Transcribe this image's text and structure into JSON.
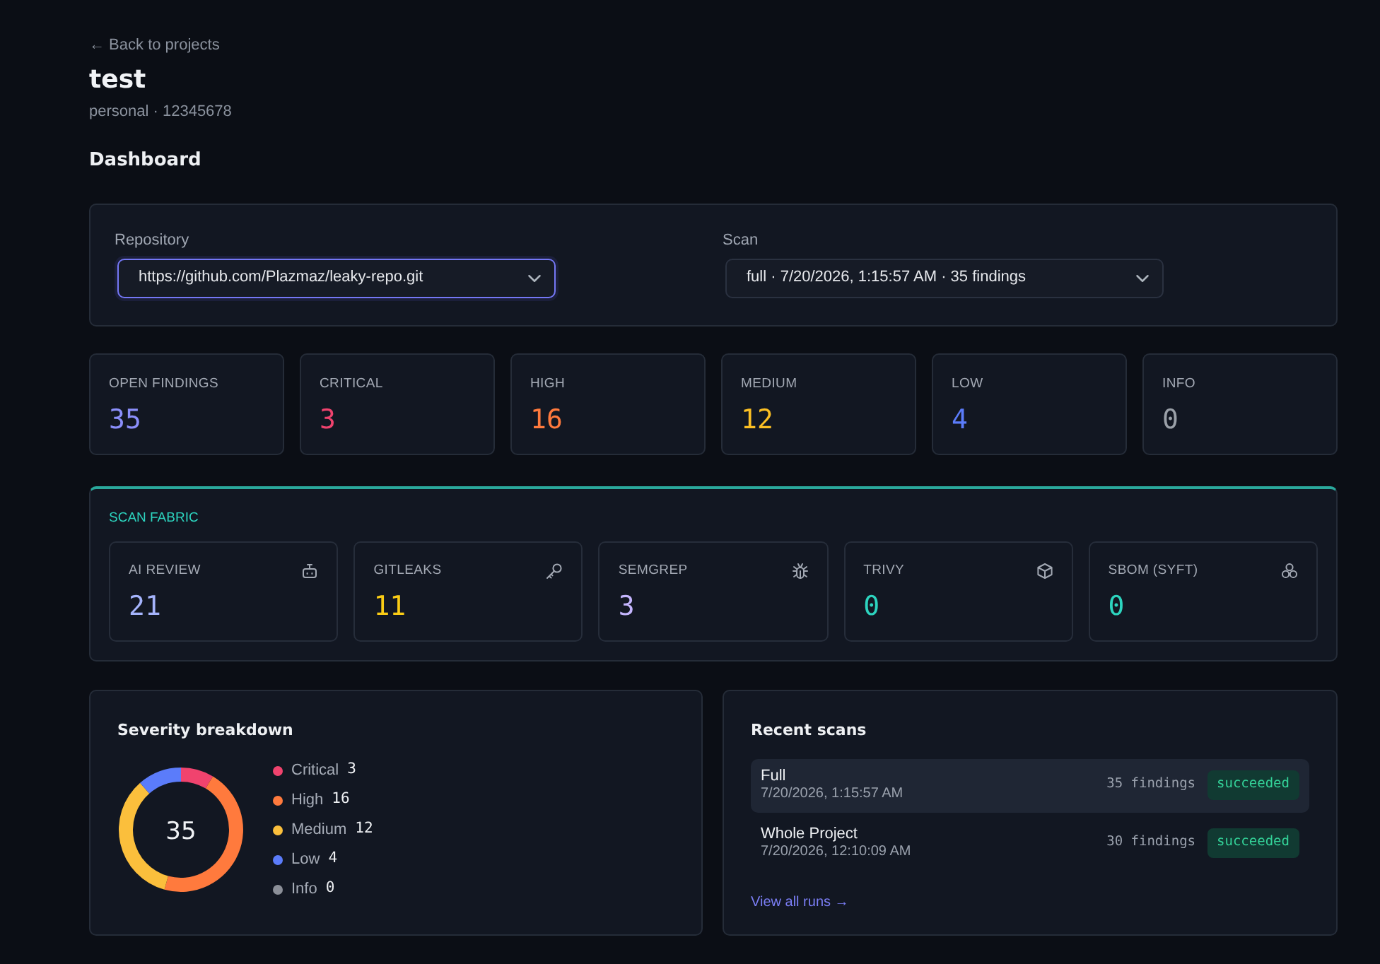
{
  "back_link": {
    "label": "← Back to projects"
  },
  "project": {
    "title": "test",
    "subtitle": "personal · 12345678"
  },
  "section_title": "Dashboard",
  "filters": [
    {
      "label": "Repository",
      "value": "https://github.com/Plazmaz/leaky-repo.git",
      "focused": true
    },
    {
      "label": "Scan",
      "value": "full · 7/20/2026, 1:15:57 AM · 35 findings",
      "focused": false
    }
  ],
  "stats": [
    {
      "label": "OPEN FINDINGS",
      "value": "35",
      "color": "#8b8ffb"
    },
    {
      "label": "CRITICAL",
      "value": "3",
      "color": "#f0436e"
    },
    {
      "label": "HIGH",
      "value": "16",
      "color": "#ff7a3d"
    },
    {
      "label": "MEDIUM",
      "value": "12",
      "color": "#fbbf24"
    },
    {
      "label": "LOW",
      "value": "4",
      "color": "#5b7cfa"
    },
    {
      "label": "INFO",
      "value": "0",
      "color": "#9aa0a8"
    }
  ],
  "scan_fabric": {
    "title": "SCAN FABRIC",
    "tools": [
      {
        "label": "AI REVIEW",
        "value": "21",
        "color": "#a5b4fc",
        "kind": "robot"
      },
      {
        "label": "GITLEAKS",
        "value": "11",
        "color": "#facc15",
        "kind": "key"
      },
      {
        "label": "SEMGREP",
        "value": "3",
        "color": "#c4b5fd",
        "kind": "bug"
      },
      {
        "label": "TRIVY",
        "value": "0",
        "color": "#2dd4bf",
        "kind": "cube"
      },
      {
        "label": "SBOM (SYFT)",
        "value": "0",
        "color": "#2dd4bf",
        "kind": "cluster"
      }
    ]
  },
  "severity_breakdown": {
    "title": "Severity breakdown",
    "total": "35",
    "chart_data": {
      "type": "donut",
      "categories": [
        "Critical",
        "High",
        "Medium",
        "Low",
        "Info"
      ],
      "values": [
        3,
        16,
        12,
        4,
        0
      ],
      "value_labels": [
        "3",
        "16",
        "12",
        "4",
        "0"
      ],
      "colors": [
        "#f0436e",
        "#ff7a3d",
        "#fbbf3c",
        "#5b7cfa",
        "#8b8f98"
      ],
      "legend": "right"
    }
  },
  "recent_scans": {
    "title": "Recent scans",
    "runs": [
      {
        "name": "Full",
        "date": "7/20/2026, 1:15:57 AM",
        "findings": "35 findings",
        "status": "succeeded",
        "selected": true
      },
      {
        "name": "Whole Project",
        "date": "7/20/2026, 12:10:09 AM",
        "findings": "30 findings",
        "status": "succeeded",
        "selected": false
      }
    ],
    "link": "View all runs →"
  }
}
